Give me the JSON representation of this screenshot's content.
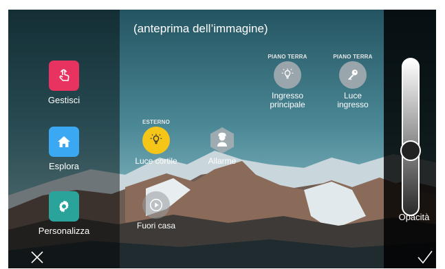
{
  "title": "(anteprima dell’immagine)",
  "menu": [
    {
      "label": "Gestisci",
      "icon": "hand-tap-icon",
      "color": "#e8325f"
    },
    {
      "label": "Esplora",
      "icon": "house-icon",
      "color": "#3aa8f2"
    },
    {
      "label": "Personalizza",
      "icon": "gear-icon",
      "color": "#2aa39a"
    }
  ],
  "devices": {
    "ingresso": {
      "zone": "PIANO TERRA",
      "label_1": "Ingresso",
      "label_2": "principale",
      "icon": "lamp-icon"
    },
    "luce_ingresso": {
      "zone": "PIANO TERRA",
      "label_1": "Luce",
      "label_2": "ingresso",
      "icon": "key-icon"
    },
    "luce_cortile": {
      "zone": "ESTERNO",
      "label": "Luce cortile",
      "icon": "lamp-icon",
      "color": "#f5c518"
    },
    "allarme": {
      "label": "Allarme",
      "icon": "guard-icon"
    },
    "fuori_casa": {
      "label": "Fuori casa",
      "icon": "scenario-icon"
    }
  },
  "opacity": {
    "label": "Opacità",
    "level": 0.4
  },
  "actions": {
    "cancel_icon": "close-icon",
    "confirm_icon": "check-icon"
  }
}
